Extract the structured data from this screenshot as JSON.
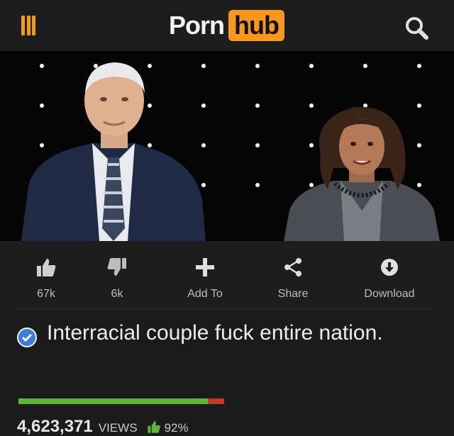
{
  "header": {
    "logo_left": "Porn",
    "logo_right": "hub",
    "accent": "#f7971d",
    "icons": [
      "menu-icon",
      "search-icon"
    ]
  },
  "video": {
    "background": "#050505",
    "people": [
      "man-in-suit",
      "woman-in-blazer"
    ]
  },
  "actions": [
    {
      "icon": "thumbs-up-icon",
      "label": "67k"
    },
    {
      "icon": "thumbs-down-icon",
      "label": "6k"
    },
    {
      "icon": "plus-icon",
      "label": "Add To"
    },
    {
      "icon": "share-icon",
      "label": "Share"
    },
    {
      "icon": "download-icon",
      "label": "Download"
    }
  ],
  "video_info": {
    "title": "Interracial couple fuck entire nation.",
    "verified_color": "#3b7ddd",
    "views": "4,623,371",
    "views_label": "VIEWS",
    "rating": "92%",
    "rating_fraction": 0.92,
    "rating_colors": {
      "positive": "#5fb23a",
      "negative": "#c0392b"
    }
  }
}
